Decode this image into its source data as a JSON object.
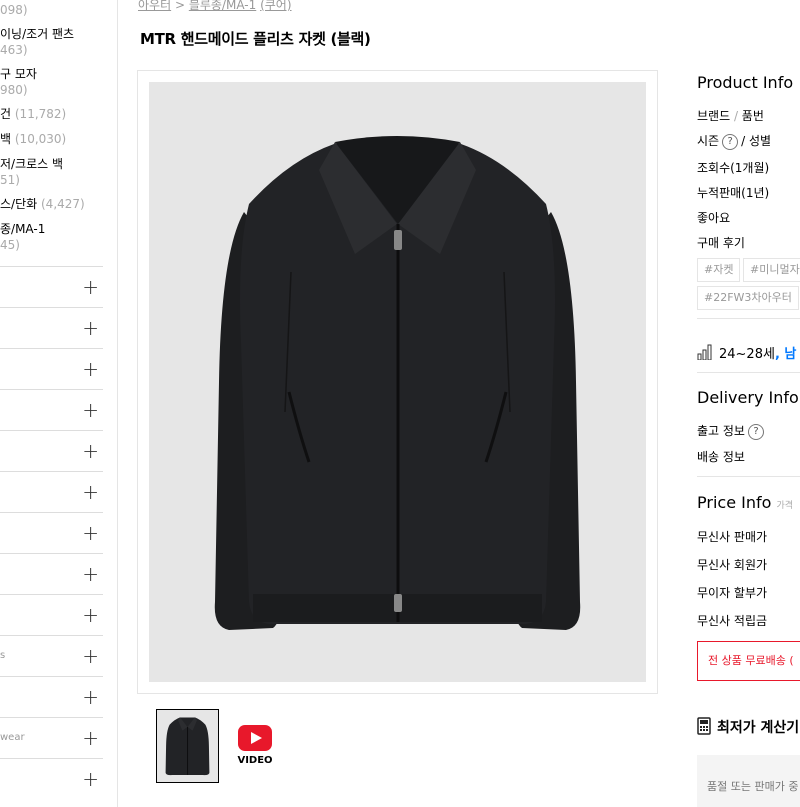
{
  "sidebar": {
    "items": [
      {
        "label": "",
        "count": "098)"
      },
      {
        "label": "이닝/조거 팬츠",
        "count": "463)"
      },
      {
        "label": "구 모자",
        "count": "980)"
      },
      {
        "label": "건",
        "count": "(11,782)"
      },
      {
        "label": "백",
        "count": "(10,030)"
      },
      {
        "label": "저/크로스 백",
        "count": "51)"
      },
      {
        "label": "스/단화",
        "count": "(4,427)"
      },
      {
        "label": "종/MA-1",
        "count": "45)"
      }
    ],
    "accordion": [
      "",
      "",
      "",
      "",
      "",
      "",
      "",
      "",
      "",
      "s",
      "",
      "wear",
      ""
    ]
  },
  "breadcrumb": {
    "cat": "아우터",
    "sep": " > ",
    "sub": "블루종/MA-1",
    "brand": "(쿠어)"
  },
  "product": {
    "title": "MTR 핸드메이드 플리츠 자켓 (블랙)"
  },
  "video": {
    "label": "VIDEO"
  },
  "info": {
    "product_title": "Product Info",
    "brand_label": "브랜드",
    "brand_sep": " / ",
    "sku_label": "품번",
    "season_label": "시즌",
    "gender_label": "/ 성별",
    "views_label": "조회수(1개월)",
    "sales_label": "누적판매(1년)",
    "likes_label": "좋아요",
    "reviews_label": "구매 후기",
    "tags": [
      "#자켓",
      "#미니멀자",
      "#22FW3차아우터"
    ],
    "age_range": "24~28세",
    "age_gender": ", 남",
    "delivery_title": "Delivery Info",
    "ship_from_label": "출고 정보",
    "shipping_label": "배송 정보",
    "price_title": "Price Info",
    "price_subtitle": "가격",
    "price_rows": [
      "무신사 판매가",
      "무신사 회원가",
      "무이자 할부가",
      "무신사 적립금"
    ],
    "free_shipping": "전 상품 무료배송 (",
    "calc_label": "최저가 계산기",
    "calc_note": "품절 또는 판매가 중"
  },
  "colors": {
    "accent_red": "#e8182b",
    "link_blue": "#0078ff"
  }
}
